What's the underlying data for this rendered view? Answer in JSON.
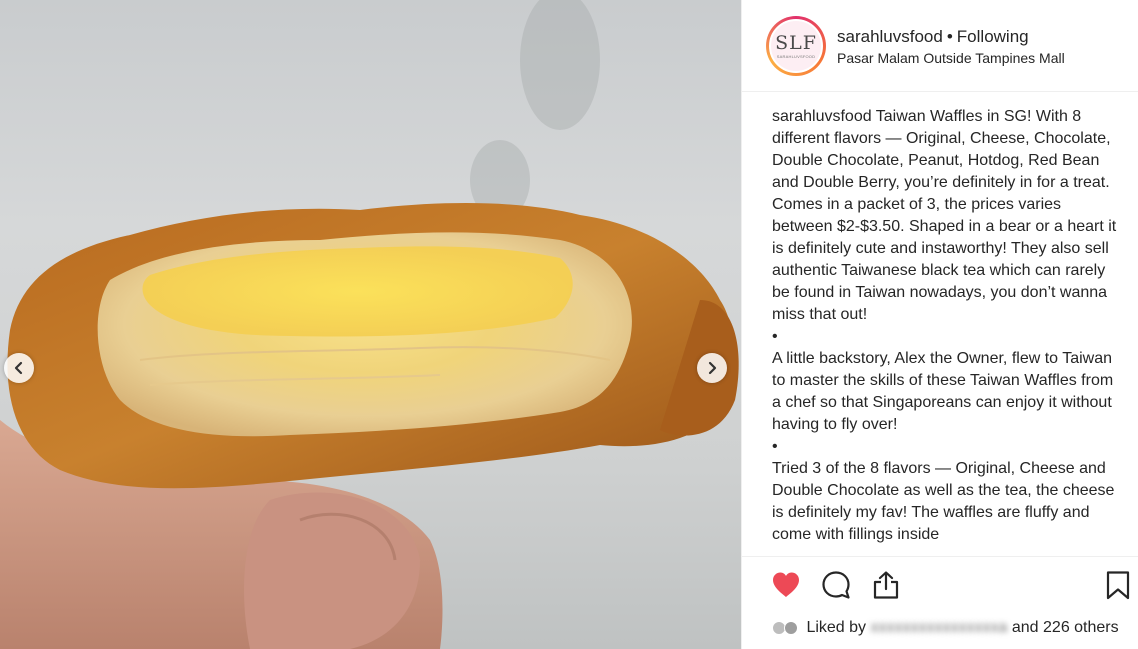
{
  "post": {
    "username": "sarahluvsfood",
    "separator": "•",
    "follow_state": "Following",
    "location": "Pasar Malam Outside Tampines Mall",
    "avatar_monogram": "SLF",
    "avatar_subtext": "SARAHLUVSFOOD"
  },
  "caption": {
    "username": "sarahluvsfood",
    "paragraph_1": "Taiwan Waffles in SG! With 8 different flavors — Original, Cheese, Chocolate, Double Chocolate, Peanut, Hotdog, Red Bean and Double Berry, you’re definitely in for a treat. Comes in a packet of 3, the prices varies between $2-$3.50. Shaped in a bear or a heart it is definitely cute and instaworthy! They also sell authentic Taiwanese black tea which can rarely be found in Taiwan nowadays, you don’t wanna miss that out!",
    "bullet_1": "•",
    "paragraph_2": "A little backstory, Alex the Owner, flew to Taiwan to master the skills of these Taiwan Waffles from a chef so that Singaporeans can enjoy it without having to fly over!",
    "bullet_2": "•",
    "paragraph_3": "Tried 3 of the 8 flavors — Original, Cheese and Double Chocolate as well as the tea, the cheese is definitely my fav! The waffles are fluffy and come with fillings inside"
  },
  "actions": {
    "like_icon": "heart-icon",
    "comment_icon": "comment-icon",
    "share_icon": "share-icon",
    "save_icon": "bookmark-icon",
    "like_color": "#ed4956"
  },
  "likes": {
    "prefix": "Liked by",
    "blurred_name": "xxxxxxxxxxxxxxxxa",
    "suffix_and": "and",
    "others": "226 others"
  },
  "photo": {
    "prev_icon": "chevron-left-icon",
    "next_icon": "chevron-right-icon"
  }
}
